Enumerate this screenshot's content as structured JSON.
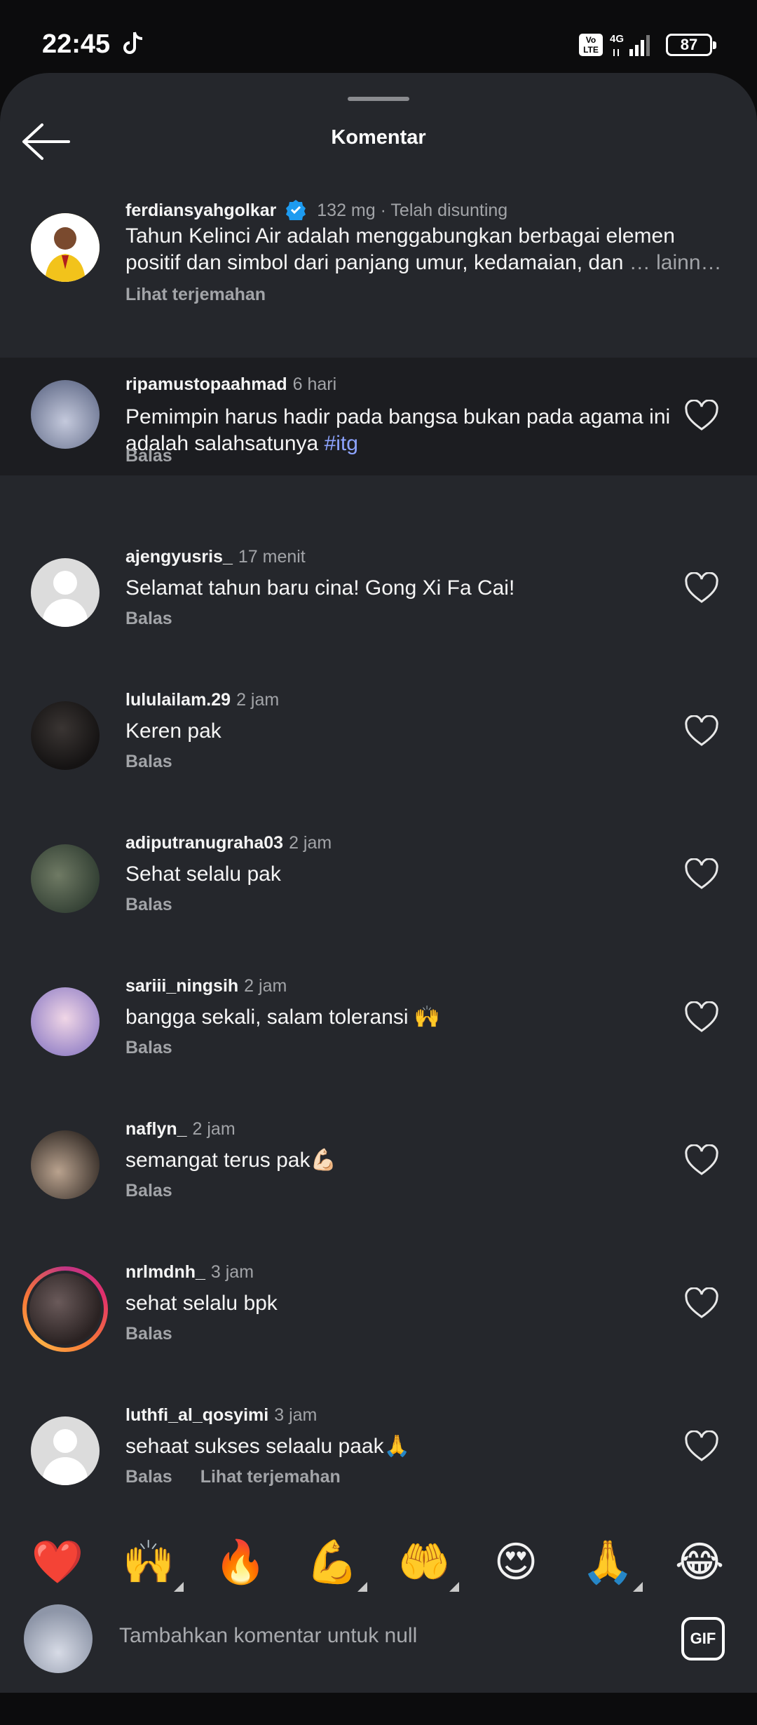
{
  "status_bar": {
    "time": "22:45",
    "battery": "87",
    "network": "4G",
    "volte": "Vo LTE"
  },
  "header": {
    "title": "Komentar"
  },
  "caption": {
    "username": "ferdiansyahgolkar",
    "time": "132 mg · Telah disunting",
    "text": "Tahun Kelinci Air adalah menggabungkan berbagai elemen positif dan simbol dari panjang umur, kedamaian, dan",
    "more": "… lainn…",
    "translate": "Lihat terjemahan"
  },
  "comments": [
    {
      "username": "ripamustopaahmad",
      "time": "6 hari",
      "text": "Pemimpin harus hadir pada bangsa bukan pada agama ini  adalah salahsatunya",
      "hashtag": "#itg",
      "reply": "Balas"
    },
    {
      "username": "ajengyusris_",
      "time": "17 menit",
      "text": "Selamat tahun baru cina! Gong Xi Fa Cai!",
      "reply": "Balas"
    },
    {
      "username": "lululailam.29",
      "time": "2 jam",
      "text": "Keren pak",
      "reply": "Balas"
    },
    {
      "username": "adiputranugraha03",
      "time": "2 jam",
      "text": "Sehat selalu pak",
      "reply": "Balas"
    },
    {
      "username": "sariii_ningsih",
      "time": "2 jam",
      "text": "bangga sekali, salam toleransi 🙌",
      "reply": "Balas"
    },
    {
      "username": "naflyn_",
      "time": "2 jam",
      "text": "semangat terus pak💪🏻",
      "reply": "Balas"
    },
    {
      "username": "nrlmdnh_",
      "time": "3 jam",
      "text": "sehat selalu bpk",
      "reply": "Balas"
    },
    {
      "username": "luthfi_al_qosyimi",
      "time": "3 jam",
      "text": "sehaat sukses selaalu paak🙏",
      "reply": "Balas",
      "translate": "Lihat terjemahan"
    }
  ],
  "emoji_bar": [
    "❤️",
    "🙌",
    "🔥",
    "💪",
    "🤲",
    "😍",
    "🙏",
    "😂"
  ],
  "compose": {
    "placeholder": "Tambahkan komentar untuk null",
    "gif_label": "GIF"
  },
  "colors": {
    "sheet": "#25272c",
    "highlight_row": "#1c1d21",
    "hashtag": "#8da4ff",
    "verified": "#1d9bf0"
  }
}
